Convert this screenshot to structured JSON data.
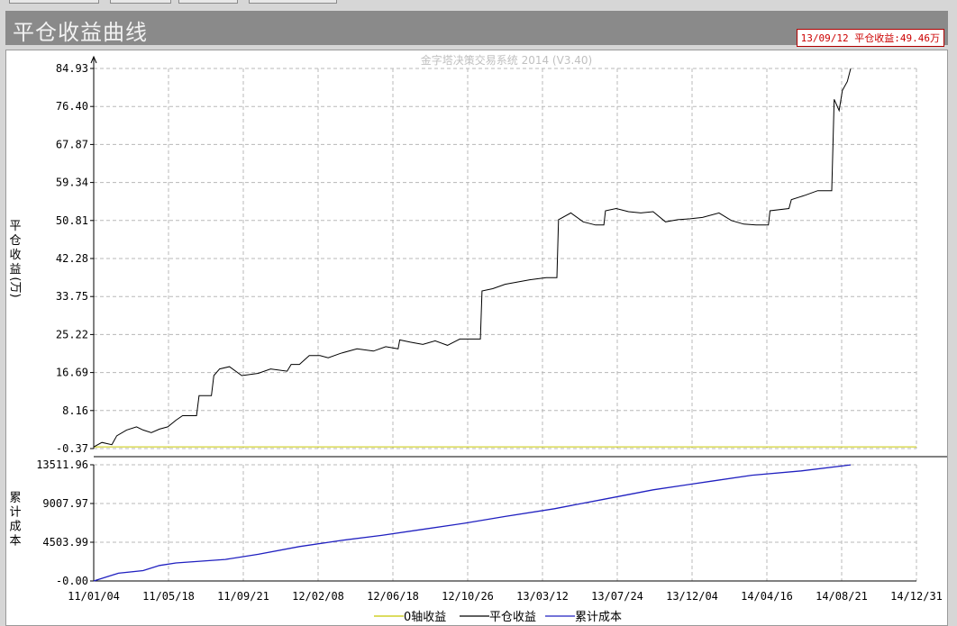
{
  "title": "平仓收益曲线",
  "status": "13/09/12 平仓收益:49.46万",
  "chart_data": [
    {
      "type": "line",
      "watermark": "金字塔决策交易系统 2014 (V3.40)",
      "ylabel": [
        "平",
        "仓",
        "收",
        "益",
        "(万)"
      ],
      "ylim": [
        -0.37,
        84.93
      ],
      "yticks": [
        "84.93",
        "76.40",
        "67.87",
        "59.34",
        "50.81",
        "42.28",
        "33.75",
        "25.22",
        "16.69",
        "8.16",
        "-0.37"
      ],
      "grid": true,
      "series": [
        {
          "name": "0轴收益",
          "color": "#c8c800",
          "values": [
            [
              0,
              0
            ],
            [
              1,
              0
            ]
          ]
        },
        {
          "name": "平仓收益",
          "color": "#000000",
          "values": [
            [
              0.0,
              0.0
            ],
            [
              0.01,
              1.0
            ],
            [
              0.022,
              0.5
            ],
            [
              0.028,
              2.5
            ],
            [
              0.04,
              3.8
            ],
            [
              0.052,
              4.5
            ],
            [
              0.06,
              3.8
            ],
            [
              0.07,
              3.2
            ],
            [
              0.08,
              4.0
            ],
            [
              0.09,
              4.5
            ],
            [
              0.1,
              6.0
            ],
            [
              0.108,
              7.0
            ],
            [
              0.125,
              7.0
            ],
            [
              0.128,
              11.5
            ],
            [
              0.143,
              11.5
            ],
            [
              0.146,
              16.0
            ],
            [
              0.153,
              17.5
            ],
            [
              0.165,
              18.0
            ],
            [
              0.18,
              16.0
            ],
            [
              0.2,
              16.5
            ],
            [
              0.215,
              17.5
            ],
            [
              0.235,
              17.0
            ],
            [
              0.24,
              18.5
            ],
            [
              0.25,
              18.5
            ],
            [
              0.262,
              20.5
            ],
            [
              0.275,
              20.5
            ],
            [
              0.285,
              20.0
            ],
            [
              0.3,
              21.0
            ],
            [
              0.32,
              22.0
            ],
            [
              0.34,
              21.5
            ],
            [
              0.355,
              22.5
            ],
            [
              0.37,
              22.0
            ],
            [
              0.372,
              24.0
            ],
            [
              0.385,
              23.5
            ],
            [
              0.4,
              23.0
            ],
            [
              0.415,
              23.8
            ],
            [
              0.43,
              22.8
            ],
            [
              0.445,
              24.2
            ],
            [
              0.47,
              24.2
            ],
            [
              0.472,
              35.0
            ],
            [
              0.485,
              35.5
            ],
            [
              0.5,
              36.5
            ],
            [
              0.515,
              37.0
            ],
            [
              0.53,
              37.5
            ],
            [
              0.55,
              38.0
            ],
            [
              0.563,
              38.0
            ],
            [
              0.565,
              51.0
            ],
            [
              0.58,
              52.5
            ],
            [
              0.595,
              50.5
            ],
            [
              0.61,
              49.8
            ],
            [
              0.62,
              49.8
            ],
            [
              0.622,
              53.0
            ],
            [
              0.635,
              53.5
            ],
            [
              0.65,
              52.8
            ],
            [
              0.665,
              52.5
            ],
            [
              0.68,
              52.8
            ],
            [
              0.695,
              50.5
            ],
            [
              0.71,
              51.0
            ],
            [
              0.725,
              51.2
            ],
            [
              0.74,
              51.5
            ],
            [
              0.76,
              52.5
            ],
            [
              0.775,
              50.8
            ],
            [
              0.79,
              50.0
            ],
            [
              0.805,
              49.8
            ],
            [
              0.82,
              49.8
            ],
            [
              0.822,
              53.0
            ],
            [
              0.845,
              53.5
            ],
            [
              0.848,
              55.5
            ],
            [
              0.865,
              56.5
            ],
            [
              0.88,
              57.5
            ],
            [
              0.897,
              57.5
            ],
            [
              0.9,
              78.0
            ],
            [
              0.906,
              75.5
            ],
            [
              0.91,
              80.0
            ],
            [
              0.916,
              82.0
            ],
            [
              0.92,
              84.9
            ]
          ]
        }
      ]
    },
    {
      "type": "line",
      "ylabel": [
        "累",
        "计",
        "成",
        "本"
      ],
      "ylim": [
        -0.0,
        13511.96
      ],
      "yticks": [
        "13511.96",
        "9007.97",
        "4503.99",
        "-0.00"
      ],
      "grid": true,
      "series": [
        {
          "name": "累计成本",
          "color": "#2020c0",
          "values": [
            [
              0.0,
              0.0
            ],
            [
              0.03,
              900.0
            ],
            [
              0.06,
              1200.0
            ],
            [
              0.08,
              1800.0
            ],
            [
              0.1,
              2100.0
            ],
            [
              0.16,
              2500.0
            ],
            [
              0.2,
              3100.0
            ],
            [
              0.25,
              4000.0
            ],
            [
              0.3,
              4700.0
            ],
            [
              0.35,
              5300.0
            ],
            [
              0.4,
              6000.0
            ],
            [
              0.45,
              6700.0
            ],
            [
              0.5,
              7500.0
            ],
            [
              0.56,
              8400.0
            ],
            [
              0.62,
              9500.0
            ],
            [
              0.68,
              10600.0
            ],
            [
              0.75,
              11600.0
            ],
            [
              0.8,
              12300.0
            ],
            [
              0.86,
              12800.0
            ],
            [
              0.92,
              13500.0
            ]
          ]
        }
      ]
    }
  ],
  "xticks": [
    "11/01/04",
    "11/05/18",
    "11/09/21",
    "12/02/08",
    "12/06/18",
    "12/10/26",
    "13/03/12",
    "13/07/24",
    "13/12/04",
    "14/04/16",
    "14/08/21",
    "14/12/31"
  ]
}
